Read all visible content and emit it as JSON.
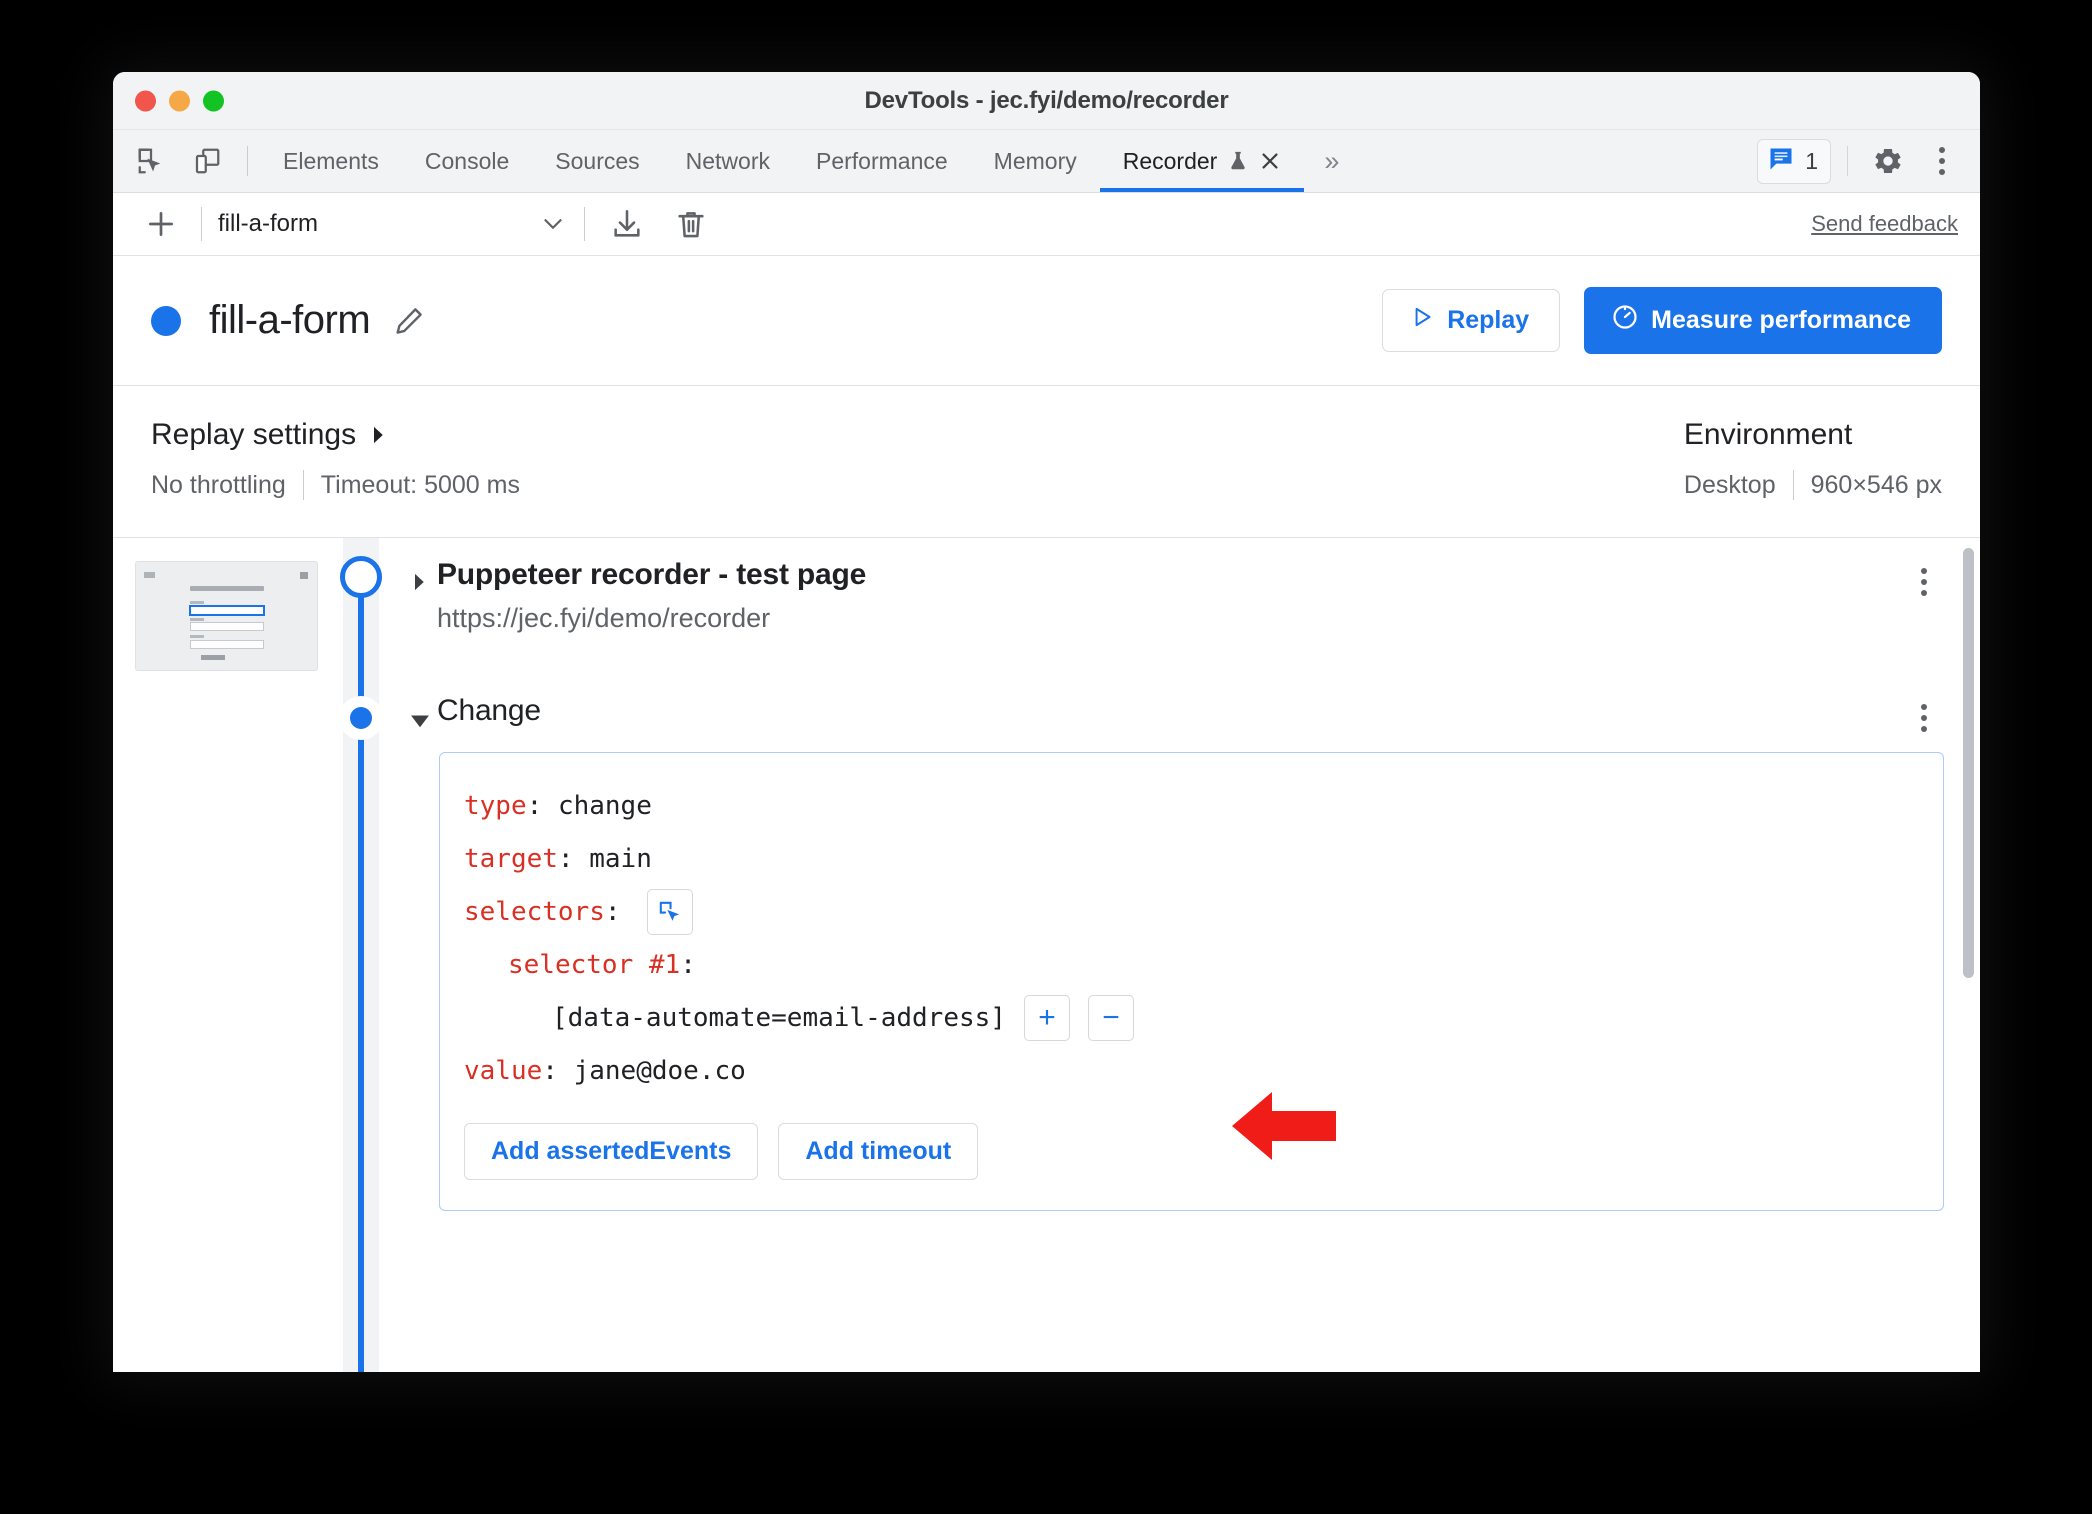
{
  "window": {
    "title": "DevTools - jec.fyi/demo/recorder",
    "traffic_lights": [
      "close-red",
      "minimize-yellow",
      "zoom-green"
    ]
  },
  "tabbar": {
    "left_icons": [
      "inspect-element-icon",
      "device-toolbar-icon"
    ],
    "tabs": [
      {
        "label": "Elements",
        "active": false
      },
      {
        "label": "Console",
        "active": false
      },
      {
        "label": "Sources",
        "active": false
      },
      {
        "label": "Network",
        "active": false
      },
      {
        "label": "Performance",
        "active": false
      },
      {
        "label": "Memory",
        "active": false
      },
      {
        "label": "Recorder",
        "active": true,
        "experiment": true,
        "closable": true
      }
    ],
    "overflow_label": "»",
    "message_count": "1",
    "right_icons": [
      "message-icon",
      "settings-gear-icon",
      "more-options-kebab-icon"
    ]
  },
  "rec_toolbar": {
    "add_label": "+",
    "selected_recording": "fill-a-form",
    "icons": [
      "chevron-down-icon",
      "export-icon",
      "delete-icon"
    ],
    "feedback_label": "Send feedback"
  },
  "rec_header": {
    "title": "fill-a-form",
    "edit_icon": "pencil-icon",
    "replay_label": "Replay",
    "replay_icon": "play-triangle-icon",
    "measure_label": "Measure performance",
    "measure_icon": "performance-gauge-icon",
    "accent_color": "#1a73e8"
  },
  "settings": {
    "replay": {
      "title": "Replay settings",
      "expand_icon": "caret-right-icon",
      "throttling": "No throttling",
      "timeout": "Timeout: 5000 ms"
    },
    "environment": {
      "title": "Environment",
      "device": "Desktop",
      "viewport": "960×546 px"
    }
  },
  "steps": {
    "navigate": {
      "title": "Puppeteer recorder - test page",
      "url": "https://jec.fyi/demo/recorder",
      "caret": "caret-right-icon",
      "kebab": "step-more-icon"
    },
    "change": {
      "title": "Change",
      "caret": "caret-down-icon",
      "kebab": "step-more-icon",
      "code": [
        {
          "key": "type",
          "sep": ":",
          "value": "change",
          "indent": 0
        },
        {
          "key": "target",
          "sep": ":",
          "value": "main",
          "indent": 0
        },
        {
          "key": "selectors",
          "sep": ":",
          "value": "",
          "indent": 0,
          "picker_icon": "selector-picker-icon"
        },
        {
          "key": "selector #1",
          "sep": ":",
          "value": "",
          "indent": 1
        },
        {
          "key": "",
          "sep": "",
          "value": "[data-automate=email-address]",
          "indent": 2,
          "add_label": "+",
          "remove_label": "−"
        },
        {
          "key": "value",
          "sep": ":",
          "value": "jane@doe.co",
          "indent": 0
        }
      ],
      "add_asserted_events_label": "Add assertedEvents",
      "add_timeout_label": "Add timeout"
    }
  },
  "annotation": {
    "arrow": "red-arrow-pointing-left",
    "color": "#ef1c17"
  }
}
